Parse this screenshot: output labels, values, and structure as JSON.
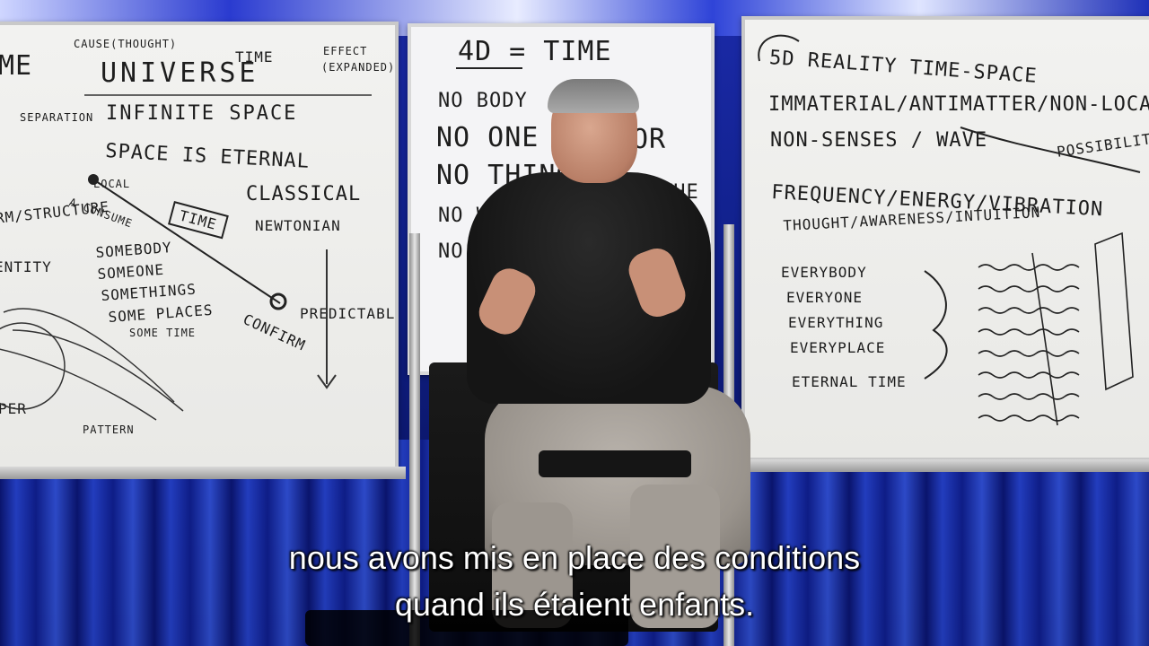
{
  "video_frame": {
    "subtitles": [
      "nous avons mis en place des conditions",
      "quand ils étaient enfants."
    ]
  },
  "boards": {
    "left": {
      "heading": "UNIVERSE",
      "notes": [
        "ME",
        "CAUSE(THOUGHT)",
        "TIME",
        "EFFECT",
        "(EXPANDED)",
        "SEPARATION",
        "INFINITE SPACE",
        "SPACE IS ETERNAL",
        "LOCAL",
        "A CONSUME",
        "TIME",
        "CLASSICAL",
        "NEWTONIAN",
        "RM/STRUCTURE",
        "ENTITY",
        "SOMEBODY",
        "SOMEONE",
        "SOMETHINGS",
        "SOME PLACES",
        "SOME TIME",
        "PREDICTABLE",
        "CONFIRM",
        "PER",
        "PATTERN"
      ]
    },
    "center": {
      "heading": "4D = TIME",
      "notes": [
        "NO BODY",
        "NO ONE",
        "NO THING",
        "NO WHERE",
        "NO TIME",
        "OR",
        "THE"
      ]
    },
    "right": {
      "heading": "5D REALITY  TIME-SPACE",
      "notes": [
        "IMMATERIAL/ANTIMATTER/NON-LOCAL",
        "NON-SENSES / WAVE",
        "POSSIBILITY",
        "FREQUENCY/ENERGY/VIBRATION",
        "THOUGHT/AWARENESS/INTUITION",
        "EVERYBODY",
        "EVERYONE",
        "EVERYTHING",
        "EVERYPLACE",
        "ETERNAL TIME"
      ]
    }
  }
}
